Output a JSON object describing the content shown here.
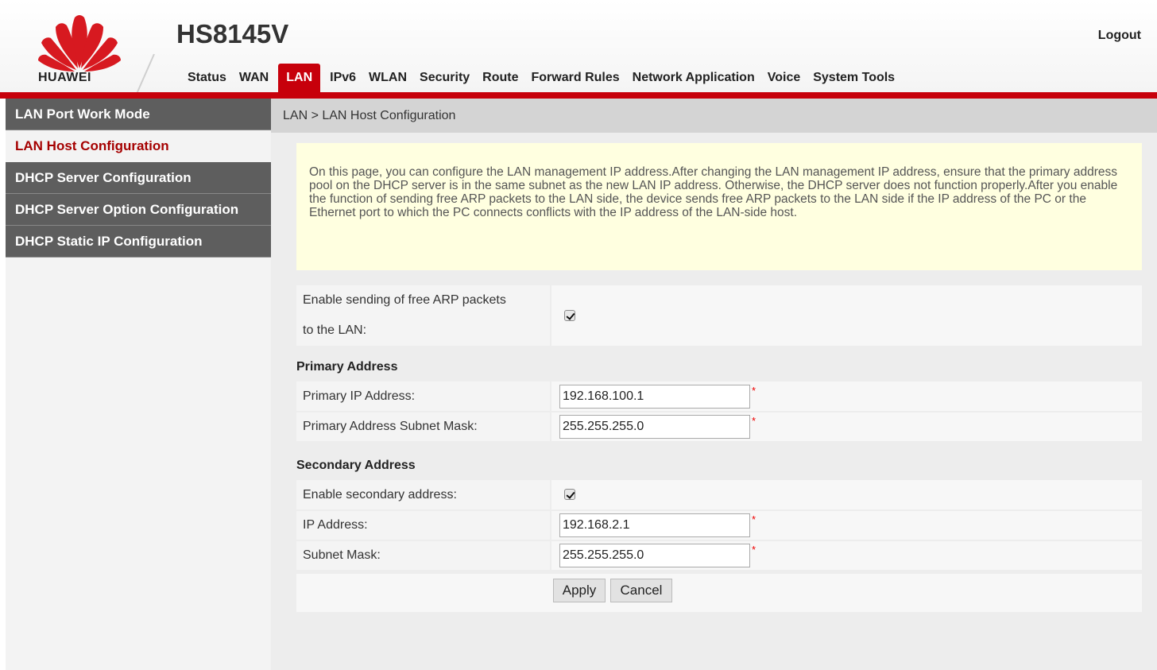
{
  "brand": {
    "logo_text": "HUAWEI",
    "accent": "#c7000b"
  },
  "header": {
    "product": "HS8145V",
    "logout_label": "Logout"
  },
  "nav": [
    {
      "label": "Status",
      "active": false
    },
    {
      "label": "WAN",
      "active": false
    },
    {
      "label": "LAN",
      "active": true
    },
    {
      "label": "IPv6",
      "active": false
    },
    {
      "label": "WLAN",
      "active": false
    },
    {
      "label": "Security",
      "active": false
    },
    {
      "label": "Route",
      "active": false
    },
    {
      "label": "Forward Rules",
      "active": false
    },
    {
      "label": "Network Application",
      "active": false
    },
    {
      "label": "Voice",
      "active": false
    },
    {
      "label": "System Tools",
      "active": false
    }
  ],
  "sidebar": {
    "items": [
      {
        "label": "LAN Port Work Mode",
        "active": false
      },
      {
        "label": "LAN Host Configuration",
        "active": true
      },
      {
        "label": "DHCP Server Configuration",
        "active": false
      },
      {
        "label": "DHCP Server Option Configuration",
        "active": false
      },
      {
        "label": "DHCP Static IP Configuration",
        "active": false
      }
    ]
  },
  "main": {
    "breadcrumb": "LAN > LAN Host Configuration",
    "help_text": "On this page, you can configure the LAN management IP address.After changing the LAN management IP address, ensure that the primary address pool on the DHCP server is in the same subnet as the new LAN IP address. Otherwise, the DHCP server does not function properly.After you enable the function of sending free ARP packets to the LAN side, the device sends free ARP packets to the LAN side if the IP address of the PC or the Ethernet port to which the PC connects conflicts with the IP address of the LAN-side host.",
    "free_arp": {
      "label_line1": "Enable sending of free ARP packets",
      "label_line2": "to the LAN:",
      "checked": true
    },
    "primary": {
      "title": "Primary Address",
      "ip_label": "Primary IP Address:",
      "ip_value": "192.168.100.1",
      "mask_label": "Primary Address Subnet Mask:",
      "mask_value": "255.255.255.0"
    },
    "secondary": {
      "title": "Secondary Address",
      "enable_label": "Enable secondary address:",
      "enabled": true,
      "ip_label": "IP Address:",
      "ip_value": "192.168.2.1",
      "mask_label": "Subnet Mask:",
      "mask_value": "255.255.255.0"
    },
    "required_mark": "*",
    "apply_label": "Apply",
    "cancel_label": "Cancel"
  }
}
